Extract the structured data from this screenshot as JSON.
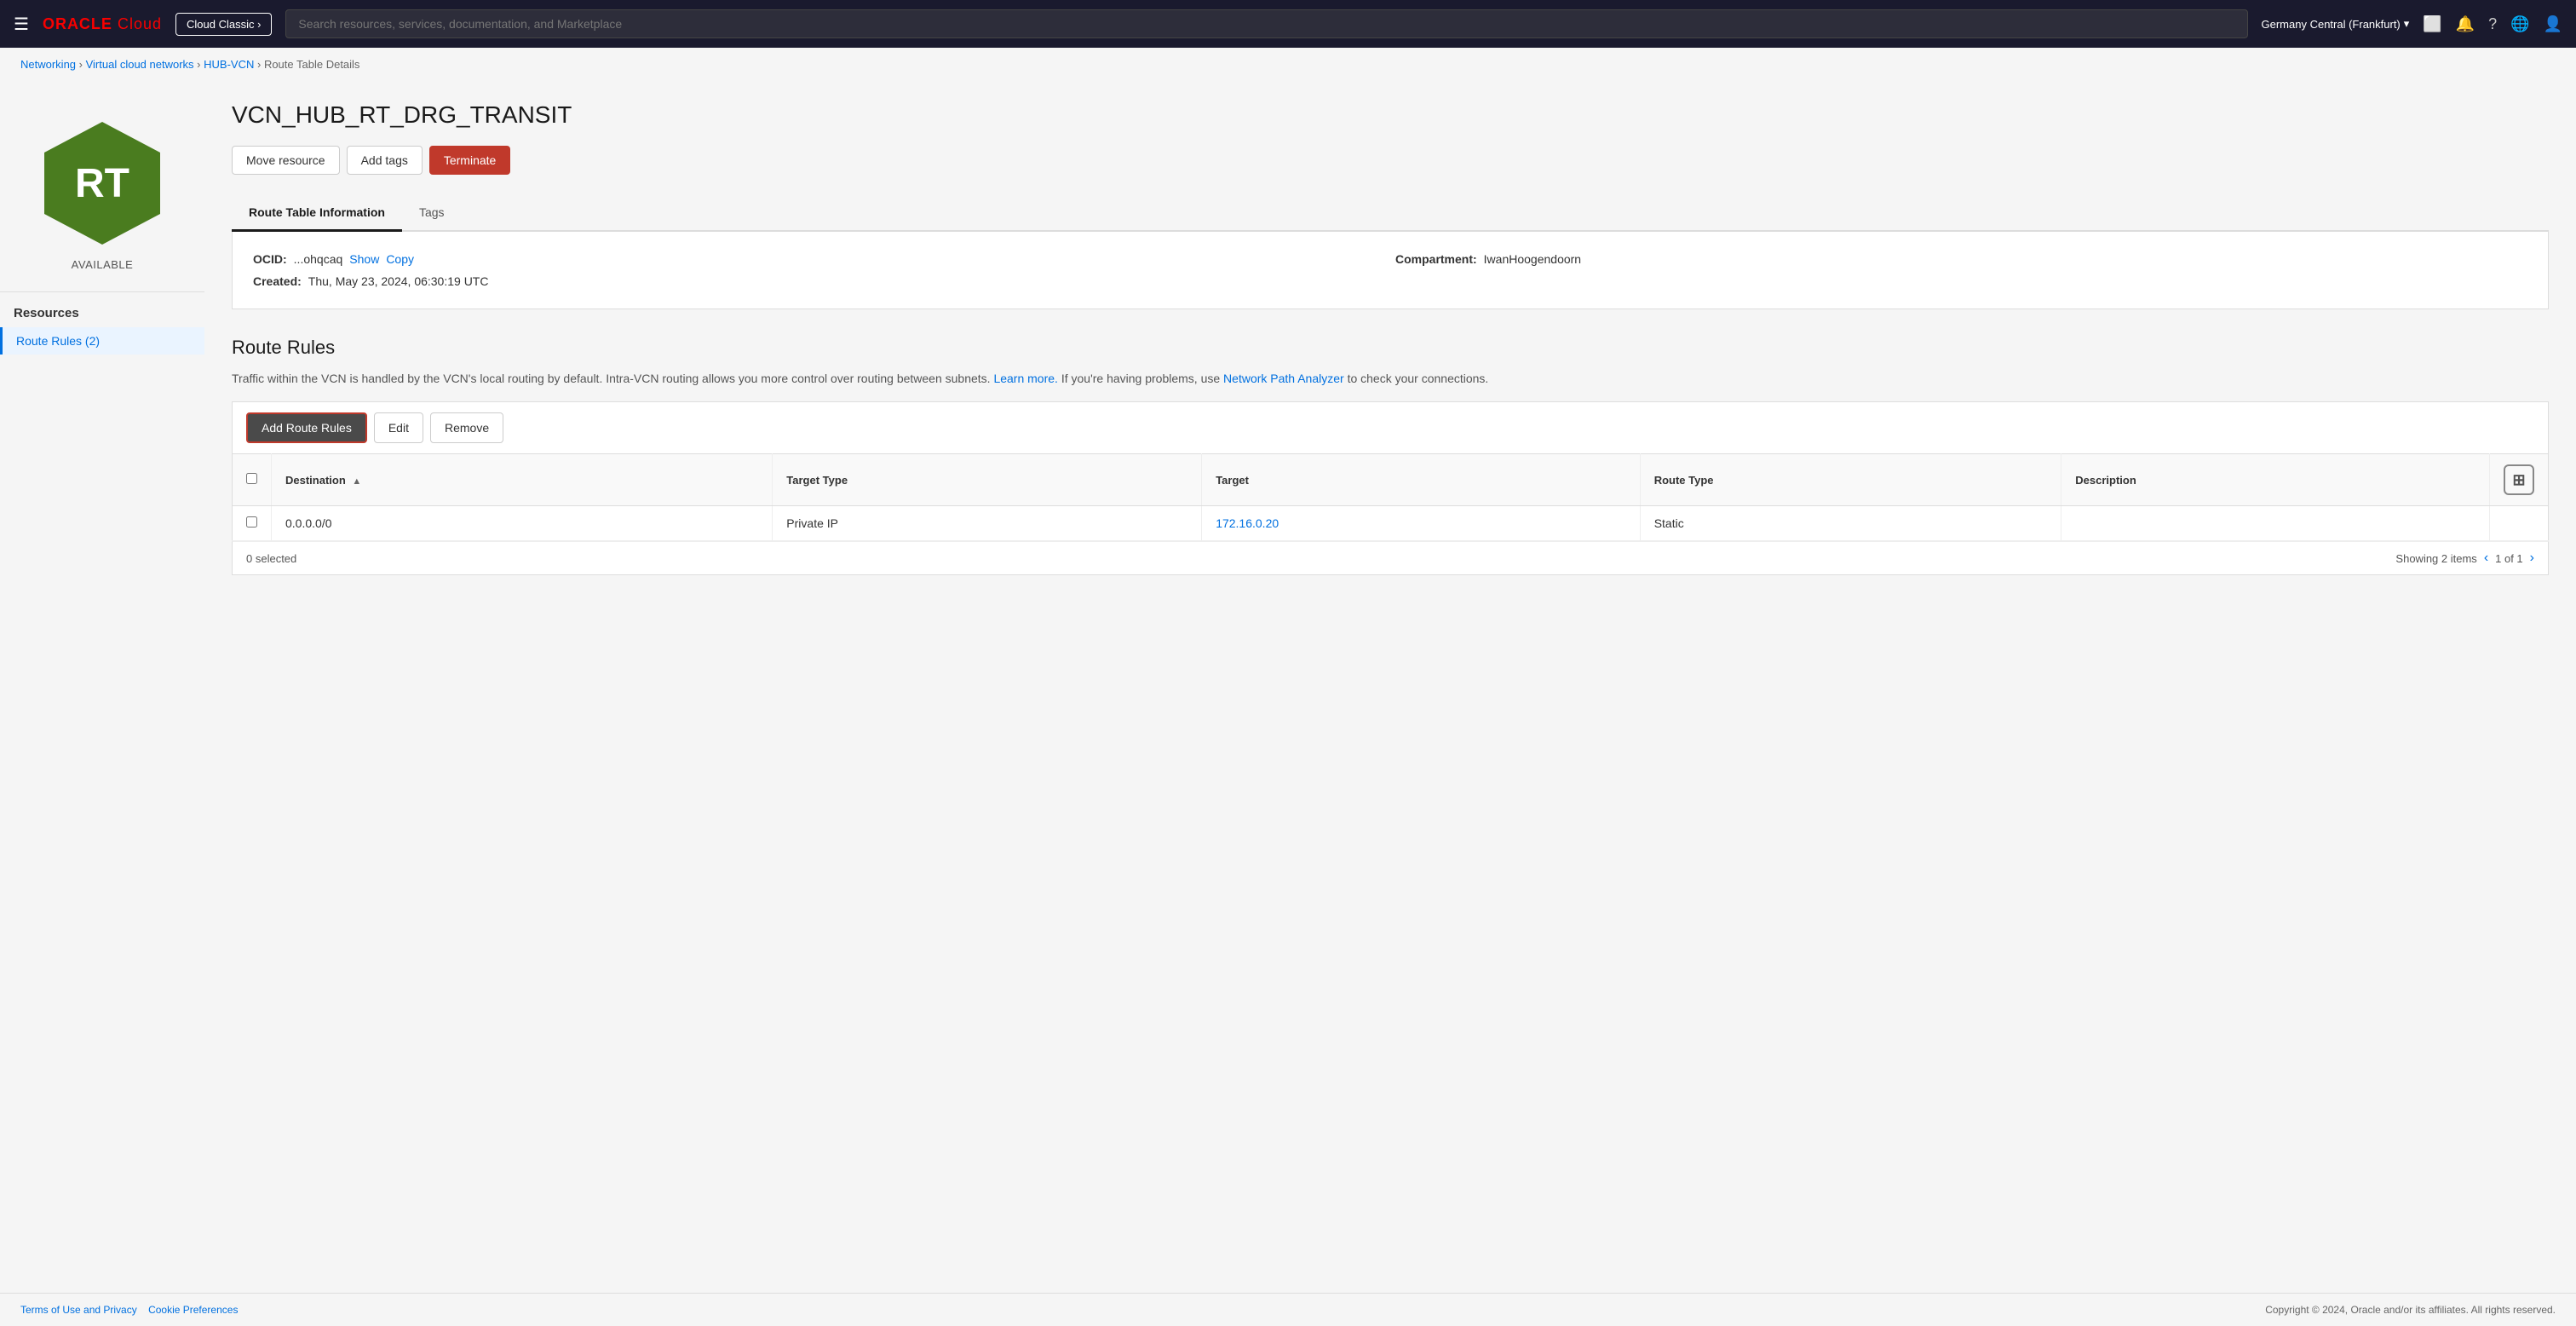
{
  "topNav": {
    "hamburger": "☰",
    "oracleText": "ORACLE",
    "cloudText": "Cloud",
    "cloudClassicLabel": "Cloud Classic ›",
    "searchPlaceholder": "Search resources, services, documentation, and Marketplace",
    "region": "Germany Central (Frankfurt)",
    "regionIcon": "▾"
  },
  "breadcrumb": {
    "items": [
      {
        "label": "Networking",
        "href": "#"
      },
      {
        "label": "Virtual cloud networks",
        "href": "#"
      },
      {
        "label": "HUB-VCN",
        "href": "#"
      },
      {
        "label": "Route Table Details",
        "href": null
      }
    ],
    "separator": "›"
  },
  "resourceIcon": {
    "initials": "RT",
    "color": "#4a7c1f",
    "status": "AVAILABLE"
  },
  "sidebar": {
    "resourcesLabel": "Resources",
    "navItems": [
      {
        "label": "Route Rules (2)",
        "active": true
      }
    ]
  },
  "pageTitle": "VCN_HUB_RT_DRG_TRANSIT",
  "actionButtons": {
    "moveResource": "Move resource",
    "addTags": "Add tags",
    "terminate": "Terminate"
  },
  "tabs": [
    {
      "label": "Route Table Information",
      "active": true
    },
    {
      "label": "Tags",
      "active": false
    }
  ],
  "infoPanel": {
    "ocidLabel": "OCID:",
    "ocidValue": "...ohqcaq",
    "ocidShowLink": "Show",
    "ocidCopyLink": "Copy",
    "compartmentLabel": "Compartment:",
    "compartmentValue": "IwanHoogendoorn",
    "createdLabel": "Created:",
    "createdValue": "Thu, May 23, 2024, 06:30:19 UTC"
  },
  "routeRules": {
    "sectionTitle": "Route Rules",
    "description": "Traffic within the VCN is handled by the VCN's local routing by default. Intra-VCN routing allows you more control over routing between subnets.",
    "learnMoreText": "Learn more.",
    "networkPathText": "Network Path Analyzer",
    "descriptionSuffix": "to check your connections.",
    "descriptionPrefix": "If you're having problems, use",
    "toolbar": {
      "addRouteRules": "Add Route Rules",
      "edit": "Edit",
      "remove": "Remove"
    },
    "tableHeaders": [
      {
        "label": "Destination",
        "sortable": true
      },
      {
        "label": "Target Type",
        "sortable": false
      },
      {
        "label": "Target",
        "sortable": false
      },
      {
        "label": "Route Type",
        "sortable": false
      },
      {
        "label": "Description",
        "sortable": false
      }
    ],
    "rows": [
      {
        "destination": "0.0.0.0/0",
        "targetType": "Private IP",
        "target": "172.16.0.20",
        "targetHref": "#",
        "routeType": "Static",
        "description": ""
      }
    ],
    "footer": {
      "selectedCount": "0 selected",
      "showing": "Showing 2 items",
      "pagination": "‹ 1 of 1 ›"
    }
  },
  "pageFooter": {
    "leftLinks": [
      {
        "label": "Terms of Use and Privacy"
      },
      {
        "label": "Cookie Preferences"
      }
    ],
    "copyright": "Copyright © 2024, Oracle and/or its affiliates. All rights reserved."
  }
}
